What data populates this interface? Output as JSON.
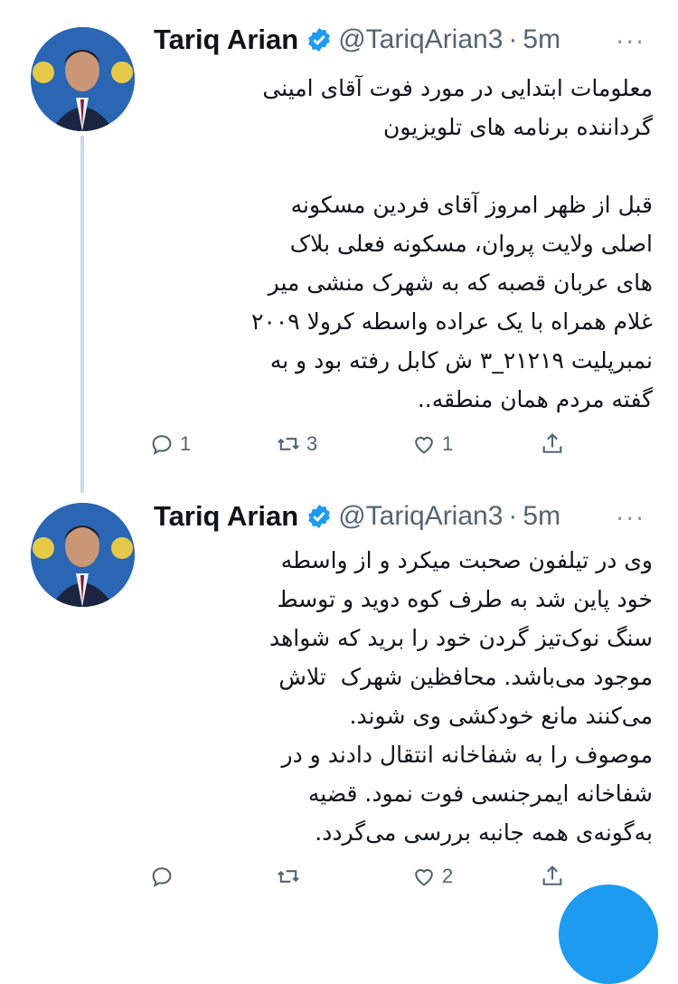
{
  "tweets": [
    {
      "author_name": "Tariq Arian",
      "handle": "@TariqArian3",
      "separator": "·",
      "time": "5m",
      "more": "···",
      "text": "معلومات ابتدایی در مورد فوت آقای امینی\nگرداننده برنامه های تلویزیون\n\nقبل از ظهر امروز آقای فردین مسکونه\nاصلی ولایت پروان، مسکونه فعلی بلاک\nهای عربان قصبه که به شهرک منشی میر\nغلام همراه با یک عراده واسطه کرولا ۲۰۰۹\nنمبرپلیت ۲۱۲۱۹_۳ ش کابل رفته بود و به\nگفته مردم همان منطقه..",
      "reply_count": "1",
      "retweet_count": "3",
      "like_count": "1"
    },
    {
      "author_name": "Tariq Arian",
      "handle": "@TariqArian3",
      "separator": "·",
      "time": "5m",
      "more": "···",
      "text": "وی در تیلفون صحبت میکرد و از واسطه\nخود پاین شد به طرف کوه دوید و توسط\nسنگ نوک‌تیز گردن خود را برید که شواهد\nموجود می‌باشد. محافظین شهرک  تلاش\nمی‌کنند مانع خودکشی وی شوند.\nموصوف را به شفاخانه انتقال دادند و در\nشفاخانه ایمرجنسی فوت نمود. قضیه\nبه‌گونه‌ی همه جانبه بررسی می‌گردد.",
      "reply_count": "",
      "retweet_count": "",
      "like_count": "2"
    }
  ],
  "colors": {
    "accent": "#1d9bf0",
    "text": "#0f1419",
    "secondary": "#536471",
    "thread_line": "#cfd9de"
  },
  "icons": [
    "verified-badge-icon",
    "more-icon",
    "reply-icon",
    "retweet-icon",
    "like-icon",
    "share-icon"
  ]
}
